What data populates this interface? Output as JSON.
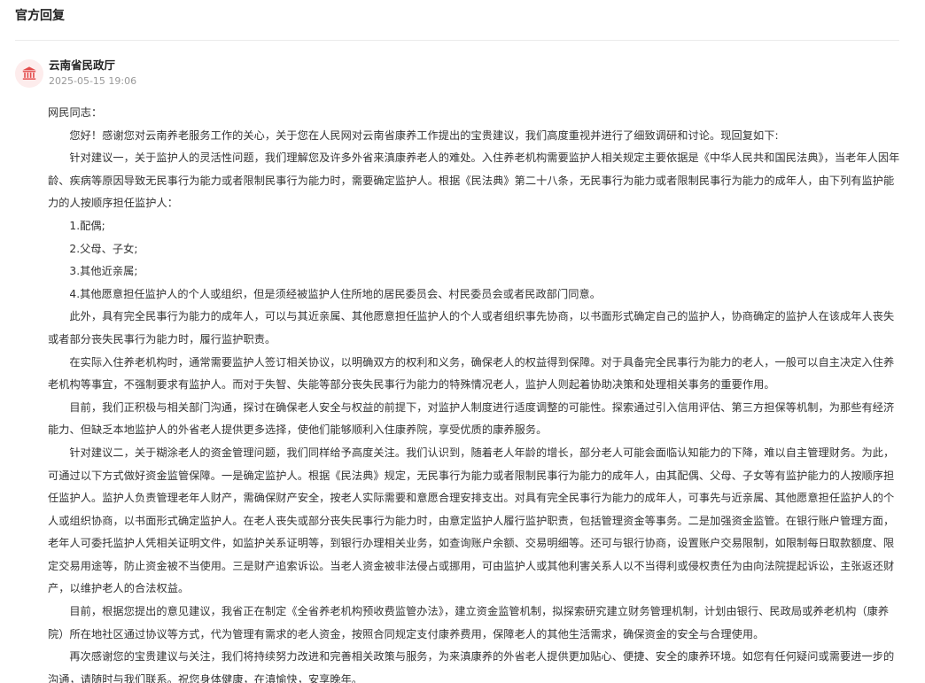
{
  "section": {
    "title": "官方回复"
  },
  "reply": {
    "avatar_icon": "government-building-icon",
    "accent_color": "#e34b4b",
    "author": "云南省民政厅",
    "time": "2025-05-15 19:06",
    "salutation": "网民同志：",
    "paragraphs": [
      "您好！感谢您对云南养老服务工作的关心，关于您在人民网对云南省康养工作提出的宝贵建议，我们高度重视并进行了细致调研和讨论。现回复如下:",
      "针对建议一，关于监护人的灵活性问题，我们理解您及许多外省来滇康养老人的难处。入住养老机构需要监护人相关规定主要依据是《中华人民共和国民法典》，当老年人因年龄、疾病等原因导致无民事行为能力或者限制民事行为能力时，需要确定监护人。根据《民法典》第二十八条，无民事行为能力或者限制民事行为能力的成年人，由下列有监护能力的人按顺序担任监护人：",
      "1.配偶;",
      "2.父母、子女;",
      "3.其他近亲属;",
      "4.其他愿意担任监护人的个人或组织，但是须经被监护人住所地的居民委员会、村民委员会或者民政部门同意。",
      "此外，具有完全民事行为能力的成年人，可以与其近亲属、其他愿意担任监护人的个人或者组织事先协商，以书面形式确定自己的监护人，协商确定的监护人在该成年人丧失或者部分丧失民事行为能力时，履行监护职责。",
      "在实际入住养老机构时，通常需要监护人签订相关协议，以明确双方的权利和义务，确保老人的权益得到保障。对于具备完全民事行为能力的老人，一般可以自主决定入住养老机构等事宜，不强制要求有监护人。而对于失智、失能等部分丧失民事行为能力的特殊情况老人，监护人则起着协助决策和处理相关事务的重要作用。",
      "目前，我们正积极与相关部门沟通，探讨在确保老人安全与权益的前提下，对监护人制度进行适度调整的可能性。探索通过引入信用评估、第三方担保等机制，为那些有经济能力、但缺乏本地监护人的外省老人提供更多选择，使他们能够顺利入住康养院，享受优质的康养服务。",
      "针对建议二，关于糊涂老人的资金管理问题，我们同样给予高度关注。我们认识到，随着老人年龄的增长，部分老人可能会面临认知能力的下降，难以自主管理财务。为此，可通过以下方式做好资金监管保障。一是确定监护人。根据《民法典》规定，无民事行为能力或者限制民事行为能力的成年人，由其配偶、父母、子女等有监护能力的人按顺序担任监护人。监护人负责管理老年人财产，需确保财产安全，按老人实际需要和意愿合理安排支出。对具有完全民事行为能力的成年人，可事先与近亲属、其他愿意担任监护人的个人或组织协商，以书面形式确定监护人。在老人丧失或部分丧失民事行为能力时，由意定监护人履行监护职责，包括管理资金等事务。二是加强资金监管。在银行账户管理方面，老年人可委托监护人凭相关证明文件，如监护关系证明等，到银行办理相关业务，如查询账户余额、交易明细等。还可与银行协商，设置账户交易限制，如限制每日取款额度、限定交易用途等，防止资金被不当使用。三是财产追索诉讼。当老人资金被非法侵占或挪用，可由监护人或其他利害关系人以不当得利或侵权责任为由向法院提起诉讼，主张返还财产，以维护老人的合法权益。",
      "目前，根据您提出的意见建议，我省正在制定《全省养老机构预收费监管办法》，建立资金监管机制，拟探索研究建立财务管理机制，计划由银行、民政局或养老机构（康养院）所在地社区通过协议等方式，代为管理有需求的老人资金，按照合同规定支付康养费用，保障老人的其他生活需求，确保资金的安全与合理使用。",
      "再次感谢您的宝贵建议与关注，我们将持续努力改进和完善相关政策与服务，为来滇康养的外省老人提供更加贴心、便捷、安全的康养环境。如您有任何疑问或需要进一步的沟通，请随时与我们联系。祝您身体健康，在滇愉快，安享晚年。"
    ]
  }
}
